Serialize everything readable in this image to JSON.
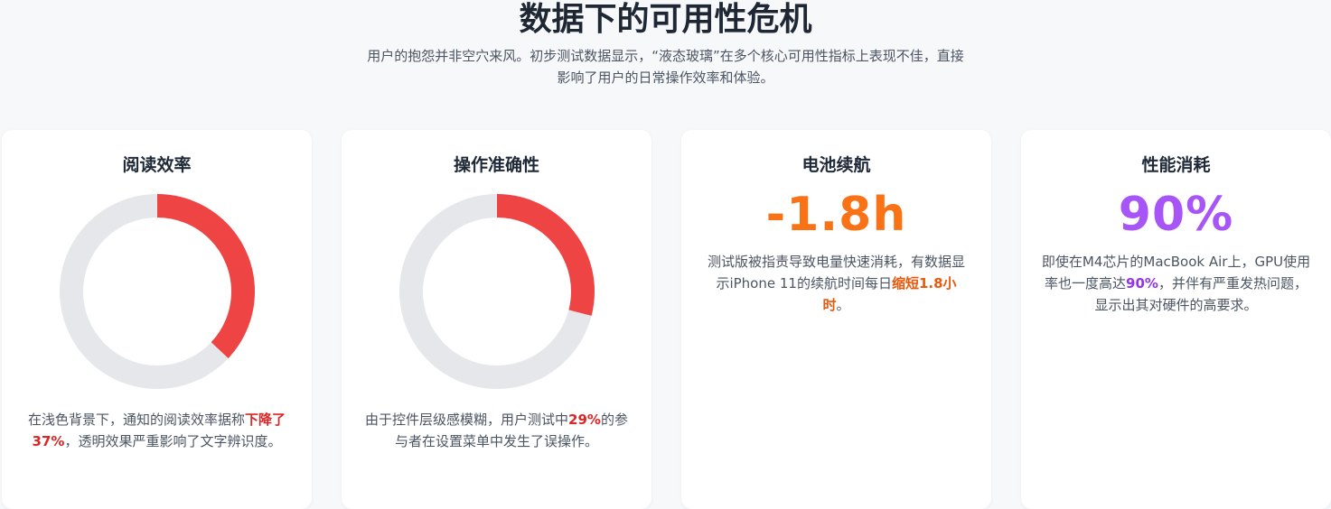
{
  "header": {
    "title": "数据下的可用性危机",
    "subtitle": "用户的抱怨并非空穴来风。初步测试数据显示，“液态玻璃”在多个核心可用性指标上表现不佳，直接影响了用户的日常操作效率和体验。"
  },
  "cards": [
    {
      "title": "阅读效率",
      "chart": {
        "type": "donut",
        "value_percent": 37,
        "fill_color": "#ef4444",
        "track_color": "#e5e7eb"
      },
      "desc_before": "在浅色背景下，通知的阅读效率据称",
      "desc_highlight": "下降了37%",
      "desc_after": "，透明效果严重影响了文字辨识度。",
      "highlight_color": "#dc2626"
    },
    {
      "title": "操作准确性",
      "chart": {
        "type": "donut",
        "value_percent": 29,
        "fill_color": "#ef4444",
        "track_color": "#e5e7eb"
      },
      "desc_before": "由于控件层级感模糊，用户测试中",
      "desc_highlight": "29%",
      "desc_after": "的参与者在设置菜单中发生了误操作。",
      "highlight_color": "#dc2626"
    },
    {
      "title": "电池续航",
      "stat": "-1.8h",
      "stat_color": "#f97316",
      "desc_before": "测试版被指责导致电量快速消耗，有数据显示iPhone 11的续航时间每日",
      "desc_highlight": "缩短1.8小时",
      "desc_after": "。",
      "highlight_color": "#ea580c"
    },
    {
      "title": "性能消耗",
      "stat": "90%",
      "stat_color": "#a855f7",
      "desc_before": "即使在M4芯片的MacBook Air上，GPU使用率也一度高达",
      "desc_highlight": "90%",
      "desc_after": "，并伴有严重发热问题，显示出其对硬件的高要求。",
      "highlight_color": "#9333ea"
    }
  ]
}
